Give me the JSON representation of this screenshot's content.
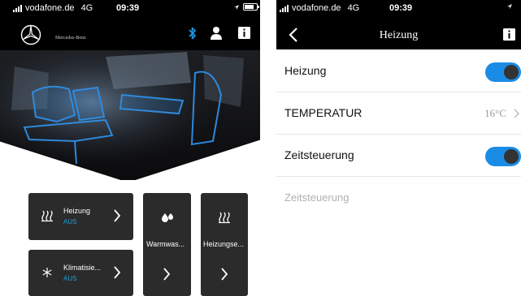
{
  "left": {
    "status": {
      "carrier": "vodafone.de",
      "network": "4G",
      "time": "09:39",
      "battery_level": 0.8
    },
    "header": {
      "brand": "Mercedes-Benz",
      "icons": [
        "mercedes-star-icon",
        "bluetooth-icon",
        "user-icon",
        "info-icon"
      ]
    },
    "tiles": [
      {
        "name": "Heizung",
        "state": "AUS",
        "icon": "heating-icon"
      },
      {
        "name": "Klimatisie...",
        "state": "AUS",
        "icon": "snowflake-icon"
      },
      {
        "name": "Warmwas...",
        "icon": "water-drops-icon"
      },
      {
        "name": "Heizungse...",
        "icon": "heating-icon"
      }
    ]
  },
  "right": {
    "status": {
      "carrier": "vodafone.de",
      "network": "4G",
      "time": "09:39"
    },
    "nav": {
      "title": "Heizung",
      "icons": [
        "back-chevron-icon",
        "info-icon"
      ]
    },
    "rows": [
      {
        "label": "Heizung",
        "toggle_on": true
      },
      {
        "label": "TEMPERATUR",
        "value": "16°C"
      },
      {
        "label": "Zeitsteuerung",
        "toggle_on": true
      }
    ],
    "section_label": "Zeitsteuerung",
    "accent_color": "#1a8ce6"
  }
}
